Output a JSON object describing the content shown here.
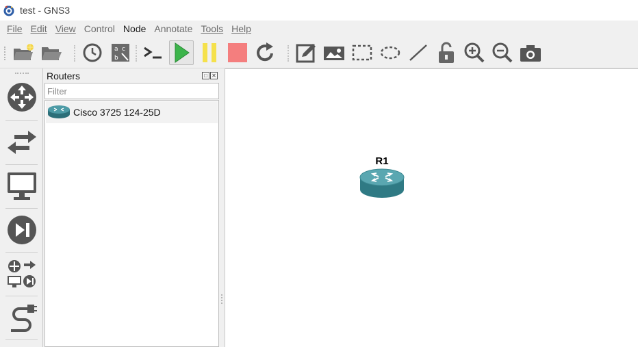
{
  "window": {
    "title": "test - GNS3"
  },
  "menu": {
    "items": [
      {
        "label": "File",
        "mnemonic": true,
        "active": false
      },
      {
        "label": "Edit",
        "mnemonic": true,
        "active": false
      },
      {
        "label": "View",
        "mnemonic": true,
        "active": false
      },
      {
        "label": "Control",
        "mnemonic": false,
        "active": false
      },
      {
        "label": "Node",
        "mnemonic": false,
        "active": true
      },
      {
        "label": "Annotate",
        "mnemonic": false,
        "active": false
      },
      {
        "label": "Tools",
        "mnemonic": true,
        "active": false
      },
      {
        "label": "Help",
        "mnemonic": true,
        "active": false
      }
    ]
  },
  "toolbar": {
    "buttons": [
      "new-project-icon",
      "open-project-icon",
      "snapshot-clock-icon",
      "show-interface-labels-icon",
      "console-icon",
      "start-icon",
      "suspend-icon",
      "stop-icon",
      "reload-icon",
      "add-note-icon",
      "insert-image-icon",
      "draw-rectangle-icon",
      "draw-ellipse-icon",
      "draw-line-icon",
      "lock-icon",
      "zoom-in-icon",
      "zoom-out-icon",
      "screenshot-icon"
    ],
    "colors": {
      "start": "#3cb44b",
      "suspend": "#f5e14c",
      "stop": "#f47e7e",
      "icon": "#555555"
    }
  },
  "device_types": {
    "items": [
      "routers-icon",
      "switches-icon",
      "end-devices-icon",
      "security-devices-icon",
      "all-devices-icon",
      "add-link-icon"
    ]
  },
  "panel": {
    "title": "Routers",
    "filter_placeholder": "Filter",
    "items": [
      {
        "label": "Cisco 3725 124-25D",
        "icon": "router-icon"
      }
    ]
  },
  "canvas": {
    "nodes": [
      {
        "label": "R1",
        "icon": "router-icon",
        "color": "#3d8a93"
      }
    ]
  }
}
